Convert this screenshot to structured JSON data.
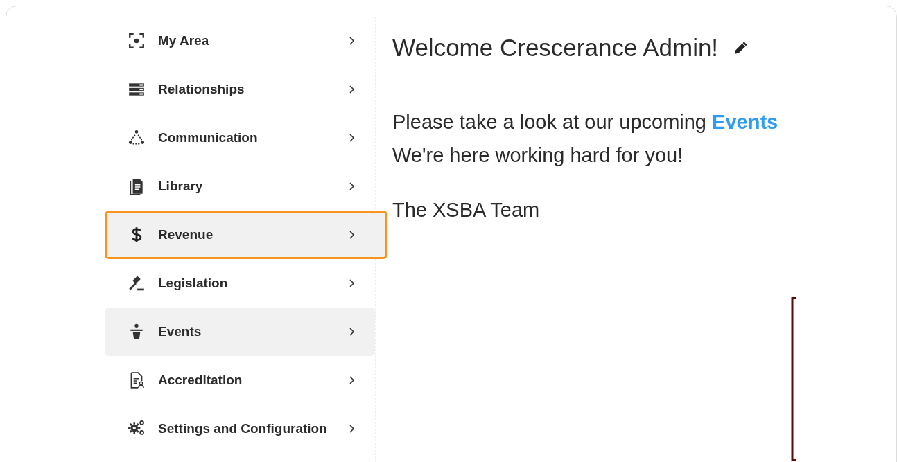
{
  "sidebar": {
    "items": [
      {
        "kind": "focus",
        "label": "My Area",
        "selected": false,
        "highlighted": false
      },
      {
        "kind": "list",
        "label": "Relationships",
        "selected": false,
        "highlighted": false
      },
      {
        "kind": "network",
        "label": "Communication",
        "selected": false,
        "highlighted": false
      },
      {
        "kind": "document",
        "label": "Library",
        "selected": false,
        "highlighted": false
      },
      {
        "kind": "dollar",
        "label": "Revenue",
        "selected": true,
        "highlighted": true
      },
      {
        "kind": "gavel",
        "label": "Legislation",
        "selected": false,
        "highlighted": false
      },
      {
        "kind": "podium",
        "label": "Events",
        "selected": true,
        "highlighted": false
      },
      {
        "kind": "certificate",
        "label": "Accreditation",
        "selected": false,
        "highlighted": false
      },
      {
        "kind": "gears",
        "label": "Settings and Configuration",
        "selected": false,
        "highlighted": false
      }
    ]
  },
  "main": {
    "title": "Welcome Crescerance Admin!",
    "message_start": "Please take a look at our upcoming ",
    "message_link": "Events",
    "message_line2": " We're here working hard for you!",
    "signature": "The XSBA Team"
  }
}
